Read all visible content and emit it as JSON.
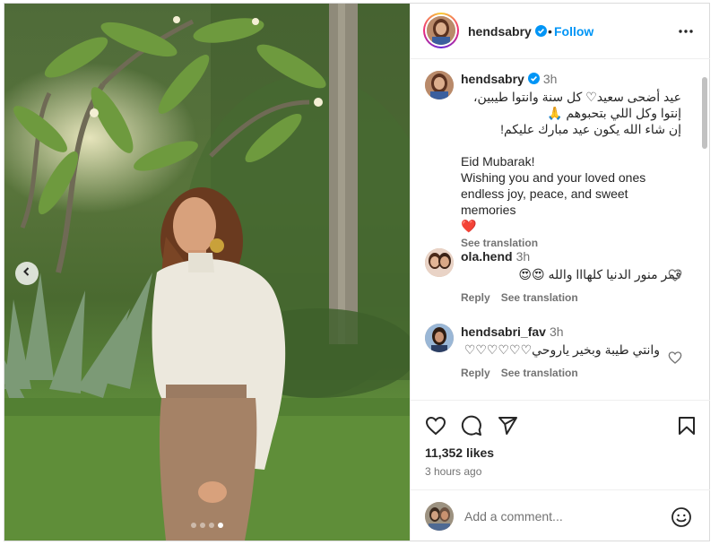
{
  "post": {
    "username": "hendsabry",
    "follow_label": "Follow",
    "separator": "•",
    "icons": {
      "verified": "verified-badge-icon",
      "more": "more-options-icon",
      "carousel_prev": "chevron-left-icon"
    }
  },
  "carousel": {
    "total": 4,
    "active_index": 3
  },
  "caption": {
    "username": "hendsabry",
    "time": "3h",
    "lines_ar": [
      "عيد أضحى سعيد♡ كل سنة وانتوا طيبين،",
      "إنتوا وكل اللي بتحبوهم 🙏",
      "إن شاء الله يكون عيد مبارك عليكم!"
    ],
    "lines_en": [
      "Eid Mubarak!",
      "Wishing you and your loved ones",
      "endless joy, peace, and sweet memories",
      "❤️"
    ],
    "see_translation": "See translation"
  },
  "comments": [
    {
      "username": "ola.hend",
      "time": "3h",
      "text": "قمر منور الدنيا كلهااا والله 😍😍",
      "reply_label": "Reply",
      "see_translation": "See translation"
    },
    {
      "username": "hendsabri_fav",
      "time": "3h",
      "text": "وانتي طيبة وبخير ياروحي♡♡♡♡♡♡",
      "reply_label": "Reply",
      "see_translation": "See translation"
    }
  ],
  "actions": {
    "like_icon": "heart-icon",
    "comment_icon": "comment-icon",
    "share_icon": "share-icon",
    "save_icon": "bookmark-icon",
    "likes": "11,352 likes",
    "time_ago": "3 hours ago"
  },
  "add_comment": {
    "placeholder": "Add a comment...",
    "emoji_icon": "emoji-icon"
  },
  "colors": {
    "accent": "#0095f6",
    "text": "#262626",
    "secondary": "#737373",
    "border": "#dbdbdb"
  }
}
